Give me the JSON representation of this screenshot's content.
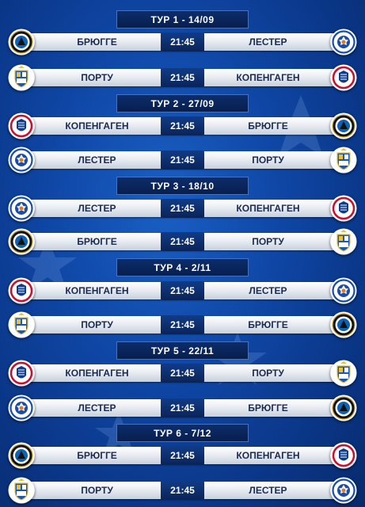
{
  "rounds": [
    {
      "title": "ТУР 1 - 14/09",
      "matches": [
        {
          "home": "БРЮГГЕ",
          "time": "21:45",
          "away": "ЛЕСТЕР",
          "home_icon": "club-brugge-crest-icon",
          "away_icon": "leicester-crest-icon"
        },
        {
          "home": "ПОРТУ",
          "time": "21:45",
          "away": "КОПЕНГАГЕН",
          "home_icon": "porto-crest-icon",
          "away_icon": "copenhagen-crest-icon"
        }
      ]
    },
    {
      "title": "ТУР 2 - 27/09",
      "matches": [
        {
          "home": "КОПЕНГАГЕН",
          "time": "21:45",
          "away": "БРЮГГЕ",
          "home_icon": "copenhagen-crest-icon",
          "away_icon": "club-brugge-crest-icon"
        },
        {
          "home": "ЛЕСТЕР",
          "time": "21:45",
          "away": "ПОРТУ",
          "home_icon": "leicester-crest-icon",
          "away_icon": "porto-crest-icon"
        }
      ]
    },
    {
      "title": "ТУР 3 - 18/10",
      "matches": [
        {
          "home": "ЛЕСТЕР",
          "time": "21:45",
          "away": "КОПЕНГАГЕН",
          "home_icon": "leicester-crest-icon",
          "away_icon": "copenhagen-crest-icon"
        },
        {
          "home": "БРЮГГЕ",
          "time": "21:45",
          "away": "ПОРТУ",
          "home_icon": "club-brugge-crest-icon",
          "away_icon": "porto-crest-icon"
        }
      ]
    },
    {
      "title": "ТУР 4 - 2/11",
      "matches": [
        {
          "home": "КОПЕНГАГЕН",
          "time": "21:45",
          "away": "ЛЕСТЕР",
          "home_icon": "copenhagen-crest-icon",
          "away_icon": "leicester-crest-icon"
        },
        {
          "home": "ПОРТУ",
          "time": "21:45",
          "away": "БРЮГГЕ",
          "home_icon": "porto-crest-icon",
          "away_icon": "club-brugge-crest-icon"
        }
      ]
    },
    {
      "title": "ТУР 5 - 22/11",
      "matches": [
        {
          "home": "КОПЕНГАГЕН",
          "time": "21:45",
          "away": "ПОРТУ",
          "home_icon": "copenhagen-crest-icon",
          "away_icon": "porto-crest-icon"
        },
        {
          "home": "ЛЕСТЕР",
          "time": "21:45",
          "away": "БРЮГГЕ",
          "home_icon": "leicester-crest-icon",
          "away_icon": "club-brugge-crest-icon"
        }
      ]
    },
    {
      "title": "ТУР 6 - 7/12",
      "matches": [
        {
          "home": "БРЮГГЕ",
          "time": "21:45",
          "away": "КОПЕНГАГЕН",
          "home_icon": "club-brugge-crest-icon",
          "away_icon": "copenhagen-crest-icon"
        },
        {
          "home": "ПОРТУ",
          "time": "21:45",
          "away": "ЛЕСТЕР",
          "home_icon": "porto-crest-icon",
          "away_icon": "leicester-crest-icon"
        }
      ]
    }
  ],
  "colors": {
    "background": "#0f47a6",
    "banner": "#0a2458",
    "time_box": "#0a2458",
    "team_text": "#1a2b52"
  }
}
